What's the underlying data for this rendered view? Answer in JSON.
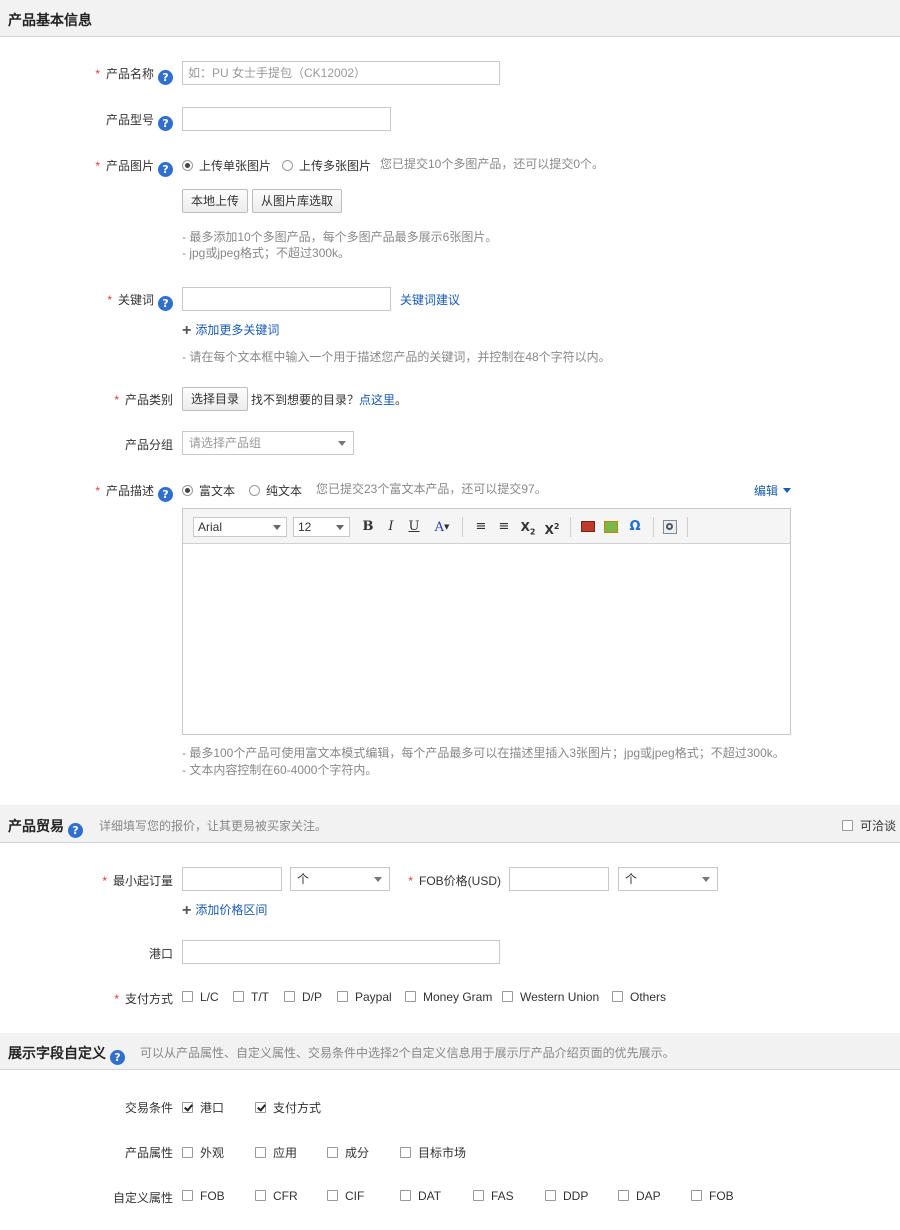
{
  "basic": {
    "title": "产品基本信息",
    "name_label": "产品名称",
    "name_placeholder": "如：PU 女士手提包（CK12002）",
    "model_label": "产品型号",
    "image_label": "产品图片",
    "image_single": "上传单张图片",
    "image_multi": "上传多张图片",
    "image_status": "您已提交10个多图产品，还可以提交0个。",
    "upload_local": "本地上传",
    "upload_library": "从图片库选取",
    "image_hint_1": "- 最多添加10个多图产品，每个多图产品最多展示6张图片。",
    "image_hint_2": "- jpg或jpeg格式；不超过300k。",
    "keyword_label": "关键词",
    "keyword_suggest": "关键词建议",
    "keyword_add_more": "添加更多关键词",
    "keyword_hint": "- 请在每个文本框中输入一个用于描述您产品的关键词，并控制在48个字符以内。",
    "category_label": "产品类别",
    "category_button": "选择目录",
    "category_not_found": "找不到想要的目录？",
    "category_click_here": "点这里",
    "category_period": "。",
    "group_label": "产品分组",
    "group_placeholder": "请选择产品组",
    "desc_label": "产品描述",
    "desc_rich": "富文本",
    "desc_plain": "纯文本",
    "desc_status": "您已提交23个富文本产品，还可以提交97。",
    "desc_edit": "编辑",
    "editor_font": "Arial",
    "editor_size": "12",
    "desc_hint_1": "- 最多100个产品可使用富文本模式编辑，每个产品最多可以在描述里插入3张图片；jpg或jpeg格式；不超过300k。",
    "desc_hint_2": "- 文本内容控制在60-4000个字符内。"
  },
  "trade": {
    "title": "产品贸易",
    "hint": "详细填写您的报价，让其更易被买家关注。",
    "negotiable": "可洽谈",
    "moq_label": "最小起订量",
    "moq_unit": "个",
    "fob_label": "FOB价格(USD)",
    "fob_unit": "个",
    "add_price_range": "添加价格区间",
    "port_label": "港口",
    "payment_label": "支付方式",
    "payments": [
      "L/C",
      "T/T",
      "D/P",
      "Paypal",
      "Money Gram",
      "Western Union",
      "Others"
    ]
  },
  "custom": {
    "title": "展示字段自定义",
    "hint": "可以从产品属性、自定义属性、交易条件中选择2个自定义信息用于展示厅产品介绍页面的优先展示。",
    "trade_terms_label": "交易条件",
    "trade_terms": [
      "港口",
      "支付方式"
    ],
    "product_attrs_label": "产品属性",
    "product_attrs": [
      "外观",
      "应用",
      "成分",
      "目标市场"
    ],
    "custom_attrs_label": "自定义属性",
    "custom_attrs": [
      "FOB",
      "CFR",
      "CIF",
      "DAT",
      "FAS",
      "DDP",
      "DAP",
      "FOB"
    ]
  },
  "icons": {
    "help": "?",
    "required": "*",
    "plus": "+"
  }
}
